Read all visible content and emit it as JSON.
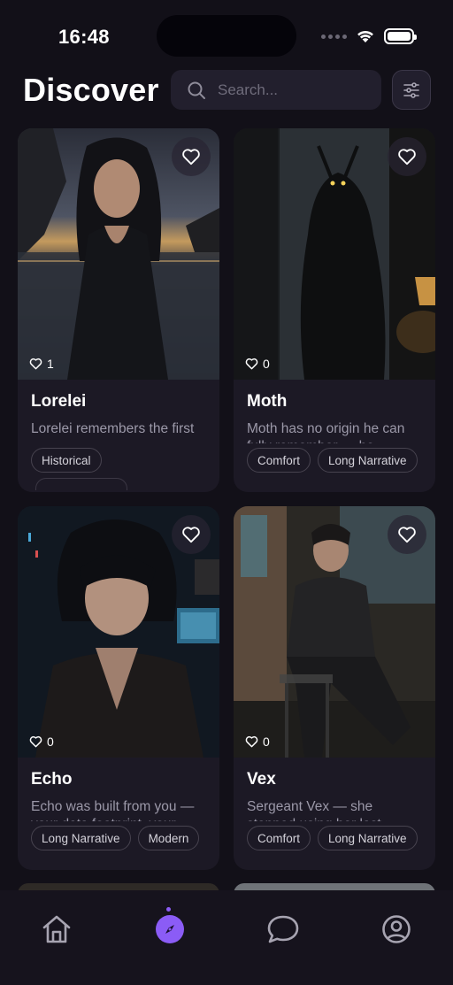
{
  "status_bar": {
    "time": "16:48"
  },
  "header": {
    "title": "Discover"
  },
  "search": {
    "placeholder": "Search..."
  },
  "cards": [
    {
      "name": "Lorelei",
      "likes": "1",
      "description": "Lorelei remembers the first",
      "tags": [
        "Historical"
      ]
    },
    {
      "name": "Moth",
      "likes": "0",
      "description": "Moth has no origin he can fully remember — he",
      "tags": [
        "Comfort",
        "Long Narrative"
      ]
    },
    {
      "name": "Echo",
      "likes": "0",
      "description": "Echo was built from you — your data footprint, your",
      "tags": [
        "Long Narrative",
        "Modern"
      ]
    },
    {
      "name": "Vex",
      "likes": "0",
      "description": "Sergeant Vex — she stopped using her last",
      "tags": [
        "Comfort",
        "Long Narrative"
      ]
    }
  ],
  "nav": {
    "items": [
      "home-icon",
      "compass-icon",
      "chat-icon",
      "profile-icon"
    ],
    "active": "compass-icon",
    "accent": "#8b5cf6"
  }
}
